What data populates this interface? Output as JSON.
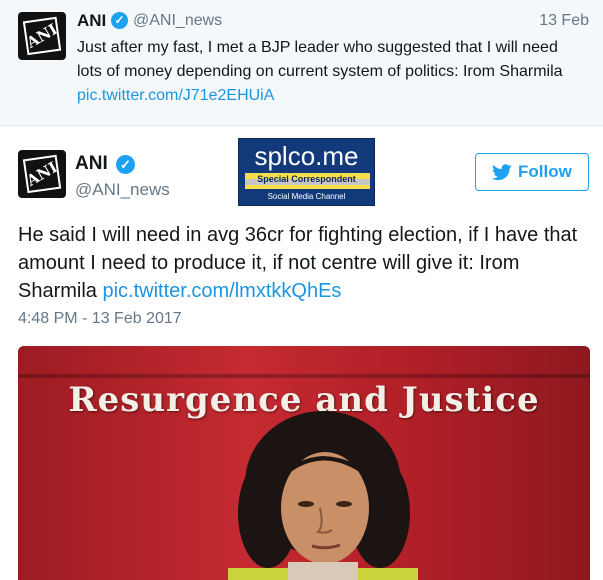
{
  "context_tweet": {
    "name": "ANI",
    "handle": "@ANI_news",
    "date": "13 Feb",
    "text": "Just after my fast, I met a BJP leader who suggested that I will need lots of money depending on current system of politics: Irom Sharmila ",
    "link": "pic.twitter.com/J71e2EHUiA",
    "avatar_text": "ANI"
  },
  "main_tweet": {
    "name": "ANI",
    "handle": "@ANI_news",
    "avatar_text": "ANI",
    "follow_label": "Follow",
    "text": "He said I will need in avg 36cr for fighting election, if I have that amount I need to produce it, if not centre will give it: Irom Sharmila ",
    "link": "pic.twitter.com/lmxtkkQhEs",
    "timestamp": "4:48 PM - 13 Feb 2017",
    "photo_caption": "Resurgence and Justice"
  },
  "watermark": {
    "title": "splco.me",
    "subtitle": "Special Correspondent",
    "tagline": "Social Media Channel"
  },
  "icons": {
    "verified": "verified-badge-icon",
    "follow": "twitter-bird-icon"
  },
  "colors": {
    "accent": "#1da1f2",
    "link": "#1b95e0",
    "muted": "#657786",
    "context_bg": "#f5f8fa"
  }
}
